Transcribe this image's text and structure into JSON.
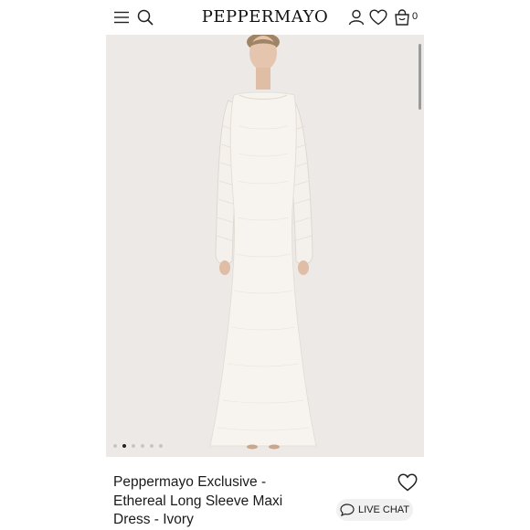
{
  "header": {
    "brand": "PEPPERMAYO",
    "cart_count": "0",
    "icons": [
      "menu-icon",
      "search-icon",
      "account-icon",
      "wishlist-icon",
      "cart-icon"
    ]
  },
  "gallery": {
    "image_description": "Model wearing ivory long sleeve maxi dress",
    "slide_count": 6,
    "active_slide": 2
  },
  "product": {
    "title": "Peppermayo Exclusive - Ethereal Long Sleeve Maxi Dress - Ivory"
  },
  "chat": {
    "label": "LIVE CHAT"
  },
  "colors": {
    "background": "#ffffff",
    "image_bg": "#ece9e6",
    "text": "#1a1a1a",
    "chat_bg": "#f1f1f1"
  }
}
